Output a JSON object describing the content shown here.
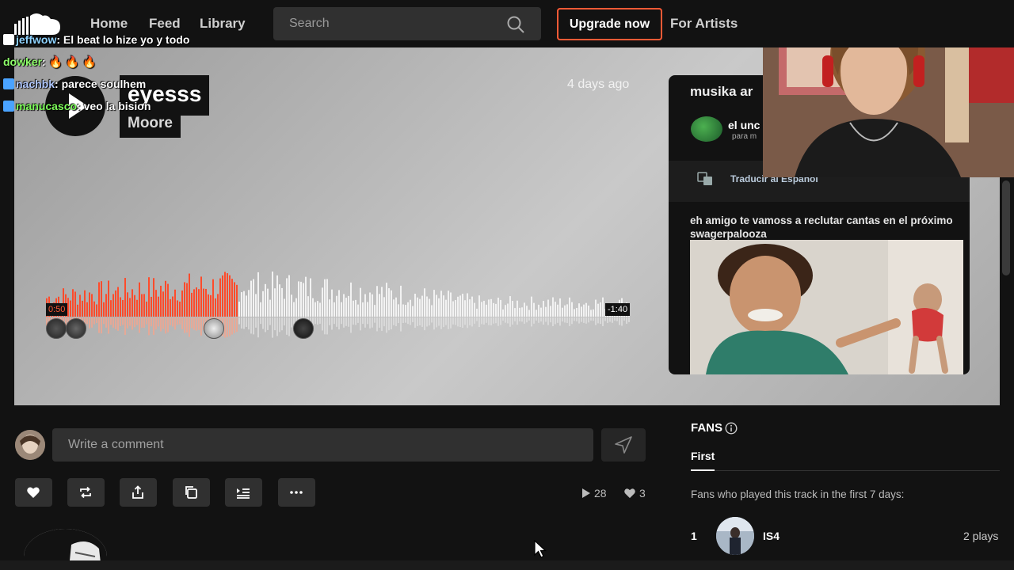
{
  "nav": {
    "home": "Home",
    "feed": "Feed",
    "library": "Library",
    "search_placeholder": "Search",
    "upgrade": "Upgrade now",
    "for_artists": "For Artists"
  },
  "track": {
    "title": "eyesss",
    "artist": "Moore",
    "posted": "4 days ago",
    "time_current": "0:50",
    "time_remaining": "-1:40",
    "progress": 0.33
  },
  "chat": [
    {
      "user": "jeffwow",
      "message": "El beat lo hize yo y todo",
      "user_color": "#8fd3ff",
      "badge_color": "#ffffff"
    },
    {
      "user": "dowker",
      "message": "🔥 🔥 🔥",
      "user_color": "#8fff6b",
      "badge_color": ""
    },
    {
      "user": "nachbk",
      "message": "parece soulhem",
      "user_color": "#b0c8ff",
      "badge_color": "#4aa3ff"
    },
    {
      "user": "manucasco",
      "message": "veo la bision",
      "user_color": "#7dff5a",
      "badge_color": "#4aa3ff"
    }
  ],
  "side_card": {
    "title": "musika ar",
    "user": "el unc",
    "sub": "para m",
    "translate": "Traducir al Español",
    "post_text": "eh amigo te vamoss a reclutar cantas en el próximo swagerpalooza"
  },
  "comment": {
    "placeholder": "Write a comment"
  },
  "stats": {
    "plays": "28",
    "likes": "3"
  },
  "fans": {
    "title": "FANS",
    "tab": "First",
    "note": "Fans who played this track in the first 7 days:",
    "rank": "1",
    "name": "IS4",
    "plays": "2 plays"
  },
  "colors": {
    "accent": "#ff5a36",
    "background": "#121212"
  }
}
